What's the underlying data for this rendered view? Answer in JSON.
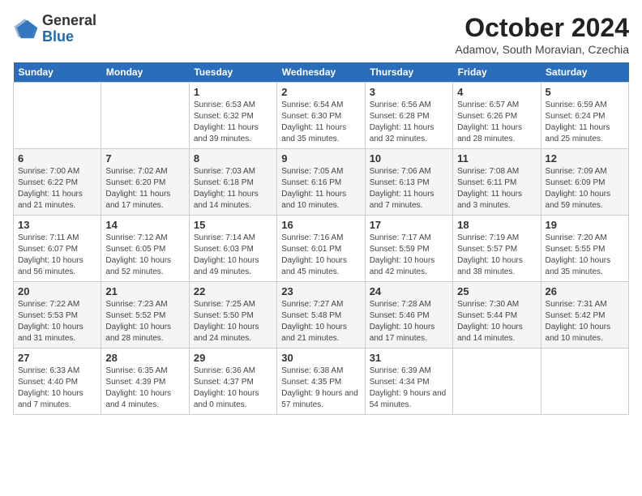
{
  "header": {
    "logo_line1": "General",
    "logo_line2": "Blue",
    "month": "October 2024",
    "location": "Adamov, South Moravian, Czechia"
  },
  "weekdays": [
    "Sunday",
    "Monday",
    "Tuesday",
    "Wednesday",
    "Thursday",
    "Friday",
    "Saturday"
  ],
  "weeks": [
    [
      {
        "day": "",
        "info": ""
      },
      {
        "day": "",
        "info": ""
      },
      {
        "day": "1",
        "info": "Sunrise: 6:53 AM\nSunset: 6:32 PM\nDaylight: 11 hours and 39 minutes."
      },
      {
        "day": "2",
        "info": "Sunrise: 6:54 AM\nSunset: 6:30 PM\nDaylight: 11 hours and 35 minutes."
      },
      {
        "day": "3",
        "info": "Sunrise: 6:56 AM\nSunset: 6:28 PM\nDaylight: 11 hours and 32 minutes."
      },
      {
        "day": "4",
        "info": "Sunrise: 6:57 AM\nSunset: 6:26 PM\nDaylight: 11 hours and 28 minutes."
      },
      {
        "day": "5",
        "info": "Sunrise: 6:59 AM\nSunset: 6:24 PM\nDaylight: 11 hours and 25 minutes."
      }
    ],
    [
      {
        "day": "6",
        "info": "Sunrise: 7:00 AM\nSunset: 6:22 PM\nDaylight: 11 hours and 21 minutes."
      },
      {
        "day": "7",
        "info": "Sunrise: 7:02 AM\nSunset: 6:20 PM\nDaylight: 11 hours and 17 minutes."
      },
      {
        "day": "8",
        "info": "Sunrise: 7:03 AM\nSunset: 6:18 PM\nDaylight: 11 hours and 14 minutes."
      },
      {
        "day": "9",
        "info": "Sunrise: 7:05 AM\nSunset: 6:16 PM\nDaylight: 11 hours and 10 minutes."
      },
      {
        "day": "10",
        "info": "Sunrise: 7:06 AM\nSunset: 6:13 PM\nDaylight: 11 hours and 7 minutes."
      },
      {
        "day": "11",
        "info": "Sunrise: 7:08 AM\nSunset: 6:11 PM\nDaylight: 11 hours and 3 minutes."
      },
      {
        "day": "12",
        "info": "Sunrise: 7:09 AM\nSunset: 6:09 PM\nDaylight: 10 hours and 59 minutes."
      }
    ],
    [
      {
        "day": "13",
        "info": "Sunrise: 7:11 AM\nSunset: 6:07 PM\nDaylight: 10 hours and 56 minutes."
      },
      {
        "day": "14",
        "info": "Sunrise: 7:12 AM\nSunset: 6:05 PM\nDaylight: 10 hours and 52 minutes."
      },
      {
        "day": "15",
        "info": "Sunrise: 7:14 AM\nSunset: 6:03 PM\nDaylight: 10 hours and 49 minutes."
      },
      {
        "day": "16",
        "info": "Sunrise: 7:16 AM\nSunset: 6:01 PM\nDaylight: 10 hours and 45 minutes."
      },
      {
        "day": "17",
        "info": "Sunrise: 7:17 AM\nSunset: 5:59 PM\nDaylight: 10 hours and 42 minutes."
      },
      {
        "day": "18",
        "info": "Sunrise: 7:19 AM\nSunset: 5:57 PM\nDaylight: 10 hours and 38 minutes."
      },
      {
        "day": "19",
        "info": "Sunrise: 7:20 AM\nSunset: 5:55 PM\nDaylight: 10 hours and 35 minutes."
      }
    ],
    [
      {
        "day": "20",
        "info": "Sunrise: 7:22 AM\nSunset: 5:53 PM\nDaylight: 10 hours and 31 minutes."
      },
      {
        "day": "21",
        "info": "Sunrise: 7:23 AM\nSunset: 5:52 PM\nDaylight: 10 hours and 28 minutes."
      },
      {
        "day": "22",
        "info": "Sunrise: 7:25 AM\nSunset: 5:50 PM\nDaylight: 10 hours and 24 minutes."
      },
      {
        "day": "23",
        "info": "Sunrise: 7:27 AM\nSunset: 5:48 PM\nDaylight: 10 hours and 21 minutes."
      },
      {
        "day": "24",
        "info": "Sunrise: 7:28 AM\nSunset: 5:46 PM\nDaylight: 10 hours and 17 minutes."
      },
      {
        "day": "25",
        "info": "Sunrise: 7:30 AM\nSunset: 5:44 PM\nDaylight: 10 hours and 14 minutes."
      },
      {
        "day": "26",
        "info": "Sunrise: 7:31 AM\nSunset: 5:42 PM\nDaylight: 10 hours and 10 minutes."
      }
    ],
    [
      {
        "day": "27",
        "info": "Sunrise: 6:33 AM\nSunset: 4:40 PM\nDaylight: 10 hours and 7 minutes."
      },
      {
        "day": "28",
        "info": "Sunrise: 6:35 AM\nSunset: 4:39 PM\nDaylight: 10 hours and 4 minutes."
      },
      {
        "day": "29",
        "info": "Sunrise: 6:36 AM\nSunset: 4:37 PM\nDaylight: 10 hours and 0 minutes."
      },
      {
        "day": "30",
        "info": "Sunrise: 6:38 AM\nSunset: 4:35 PM\nDaylight: 9 hours and 57 minutes."
      },
      {
        "day": "31",
        "info": "Sunrise: 6:39 AM\nSunset: 4:34 PM\nDaylight: 9 hours and 54 minutes."
      },
      {
        "day": "",
        "info": ""
      },
      {
        "day": "",
        "info": ""
      }
    ]
  ]
}
